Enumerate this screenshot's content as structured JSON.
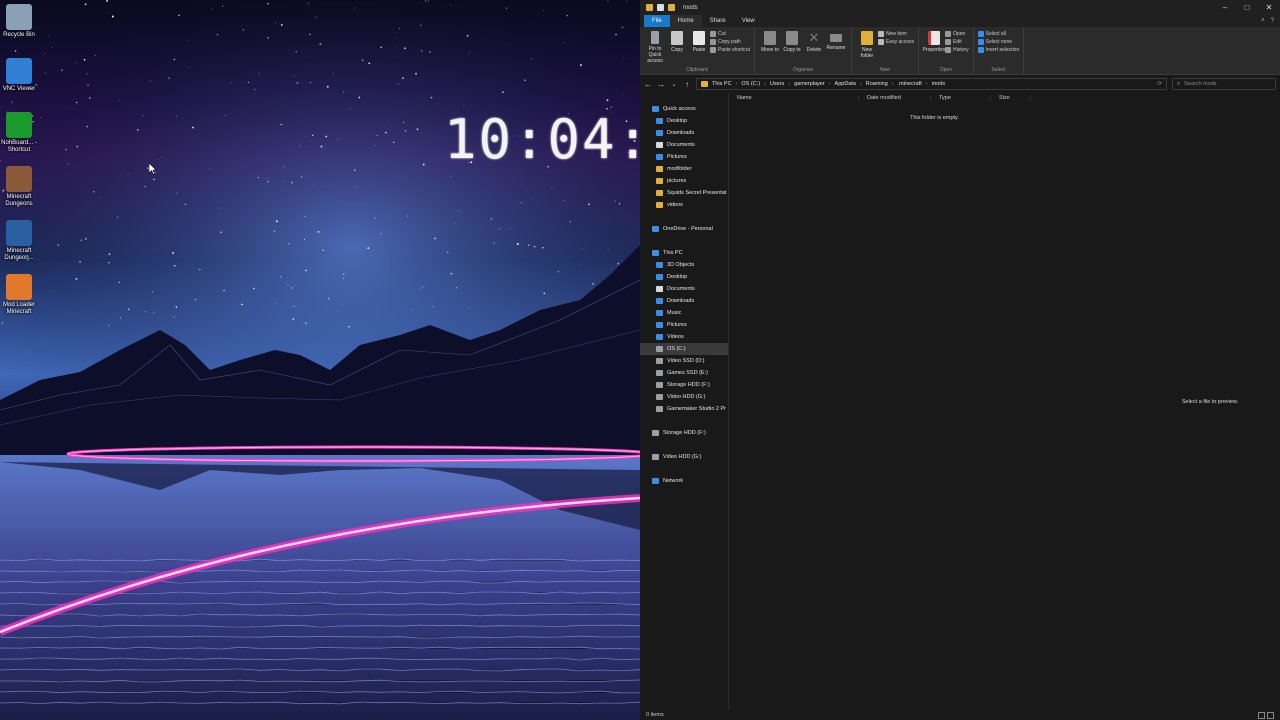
{
  "desktop": {
    "clock": "10:04:",
    "icons": [
      {
        "label": "Recycle Bin",
        "icon": "recycle-bin-icon",
        "color": "#8aa0b4"
      },
      {
        "label": "VNC Viewer",
        "icon": "vnc-viewer-icon",
        "color": "#2f7fd4"
      },
      {
        "label": "NohBoard... - Shortcut",
        "icon": "nohboard-icon",
        "color": "#1a9a2a"
      },
      {
        "label": "Minecraft Dungeons",
        "icon": "minecraft-dungeons-icon",
        "color": "#8a5a3a"
      },
      {
        "label": "Minecraft Dungeon...",
        "icon": "music-note-icon",
        "color": "#2a5fa0"
      },
      {
        "label": "Mod Loader Minecraft",
        "icon": "java-installer-icon",
        "color": "#e07a2a"
      }
    ]
  },
  "explorer": {
    "title": "mods",
    "tabs": [
      "File",
      "Home",
      "Share",
      "View"
    ],
    "ribbon": {
      "clipboard": {
        "name": "Clipboard",
        "pin": "Pin to Quick access",
        "copy": "Copy",
        "paste": "Paste",
        "cut": "Cut",
        "copy_path": "Copy path",
        "paste_shortcut": "Paste shortcut"
      },
      "organize": {
        "name": "Organize",
        "move_to": "Move to",
        "copy_to": "Copy to",
        "delete": "Delete",
        "rename": "Rename"
      },
      "new": {
        "name": "New",
        "new_folder": "New folder",
        "new_item": "New item",
        "easy_access": "Easy access"
      },
      "open": {
        "name": "Open",
        "properties": "Properties",
        "open": "Open",
        "edit": "Edit",
        "history": "History"
      },
      "select": {
        "name": "Select",
        "select_all": "Select all",
        "select_none": "Select none",
        "invert": "Invert selection"
      }
    },
    "path": [
      "This PC",
      "OS (C:)",
      "Users",
      "gamerplayer",
      "AppData",
      "Roaming",
      ".minecraft",
      "mods"
    ],
    "search_placeholder": "Search mods",
    "nav": [
      {
        "label": "Quick access",
        "icon": "star-icon",
        "color": "#3a8ee6",
        "indent": 0
      },
      {
        "label": "Desktop",
        "icon": "desktop-icon",
        "color": "#3a8ee6",
        "indent": 1
      },
      {
        "label": "Downloads",
        "icon": "download-icon",
        "color": "#3a8ee6",
        "indent": 1
      },
      {
        "label": "Documents",
        "icon": "document-icon",
        "color": "#d8d8d8",
        "indent": 1
      },
      {
        "label": "Pictures",
        "icon": "pictures-icon",
        "color": "#3a8ee6",
        "indent": 1
      },
      {
        "label": "modfolder",
        "icon": "folder-icon",
        "color": "#e0b03a",
        "indent": 1
      },
      {
        "label": "pictures",
        "icon": "folder-icon",
        "color": "#e0b03a",
        "indent": 1
      },
      {
        "label": "Squids Secret Presentat",
        "icon": "folder-icon",
        "color": "#e0b03a",
        "indent": 1
      },
      {
        "label": "videos",
        "icon": "folder-icon",
        "color": "#e0b03a",
        "indent": 1
      },
      {
        "label": "",
        "icon": "",
        "color": "",
        "indent": 0
      },
      {
        "label": "OneDrive - Personal",
        "icon": "cloud-icon",
        "color": "#3a8ee6",
        "indent": 0
      },
      {
        "label": "",
        "icon": "",
        "color": "",
        "indent": 0
      },
      {
        "label": "This PC",
        "icon": "computer-icon",
        "color": "#3a8ee6",
        "indent": 0
      },
      {
        "label": "3D Objects",
        "icon": "3d-objects-icon",
        "color": "#3a8ee6",
        "indent": 1
      },
      {
        "label": "Desktop",
        "icon": "desktop-icon",
        "color": "#3a8ee6",
        "indent": 1
      },
      {
        "label": "Documents",
        "icon": "document-icon",
        "color": "#d8d8d8",
        "indent": 1
      },
      {
        "label": "Downloads",
        "icon": "download-icon",
        "color": "#3a8ee6",
        "indent": 1
      },
      {
        "label": "Music",
        "icon": "music-icon",
        "color": "#3a8ee6",
        "indent": 1
      },
      {
        "label": "Pictures",
        "icon": "pictures-icon",
        "color": "#3a8ee6",
        "indent": 1
      },
      {
        "label": "Videos",
        "icon": "video-icon",
        "color": "#3a8ee6",
        "indent": 1
      },
      {
        "label": "OS (C:)",
        "icon": "drive-icon",
        "color": "#9aa0a6",
        "indent": 1,
        "selected": true
      },
      {
        "label": "Video SSD (D:)",
        "icon": "drive-icon",
        "color": "#9aa0a6",
        "indent": 1
      },
      {
        "label": "Games SSD (E:)",
        "icon": "drive-icon",
        "color": "#9aa0a6",
        "indent": 1
      },
      {
        "label": "Storage HDD (F:)",
        "icon": "drive-icon",
        "color": "#9aa0a6",
        "indent": 1
      },
      {
        "label": "Video HDD (G:)",
        "icon": "drive-icon",
        "color": "#9aa0a6",
        "indent": 1
      },
      {
        "label": "Gamemaker Studio 2 Pr",
        "icon": "drive-icon",
        "color": "#9aa0a6",
        "indent": 1
      },
      {
        "label": "",
        "icon": "",
        "color": "",
        "indent": 0
      },
      {
        "label": "Storage HDD (F:)",
        "icon": "drive-icon",
        "color": "#9aa0a6",
        "indent": 0
      },
      {
        "label": "",
        "icon": "",
        "color": "",
        "indent": 0
      },
      {
        "label": "Video HDD (G:)",
        "icon": "drive-icon",
        "color": "#9aa0a6",
        "indent": 0
      },
      {
        "label": "",
        "icon": "",
        "color": "",
        "indent": 0
      },
      {
        "label": "Network",
        "icon": "network-icon",
        "color": "#3a8ee6",
        "indent": 0
      }
    ],
    "columns": [
      "Name",
      "Date modified",
      "Type",
      "Size"
    ],
    "empty_message": "This folder is empty.",
    "preview_message": "Select a file to preview.",
    "status": "0 items"
  }
}
